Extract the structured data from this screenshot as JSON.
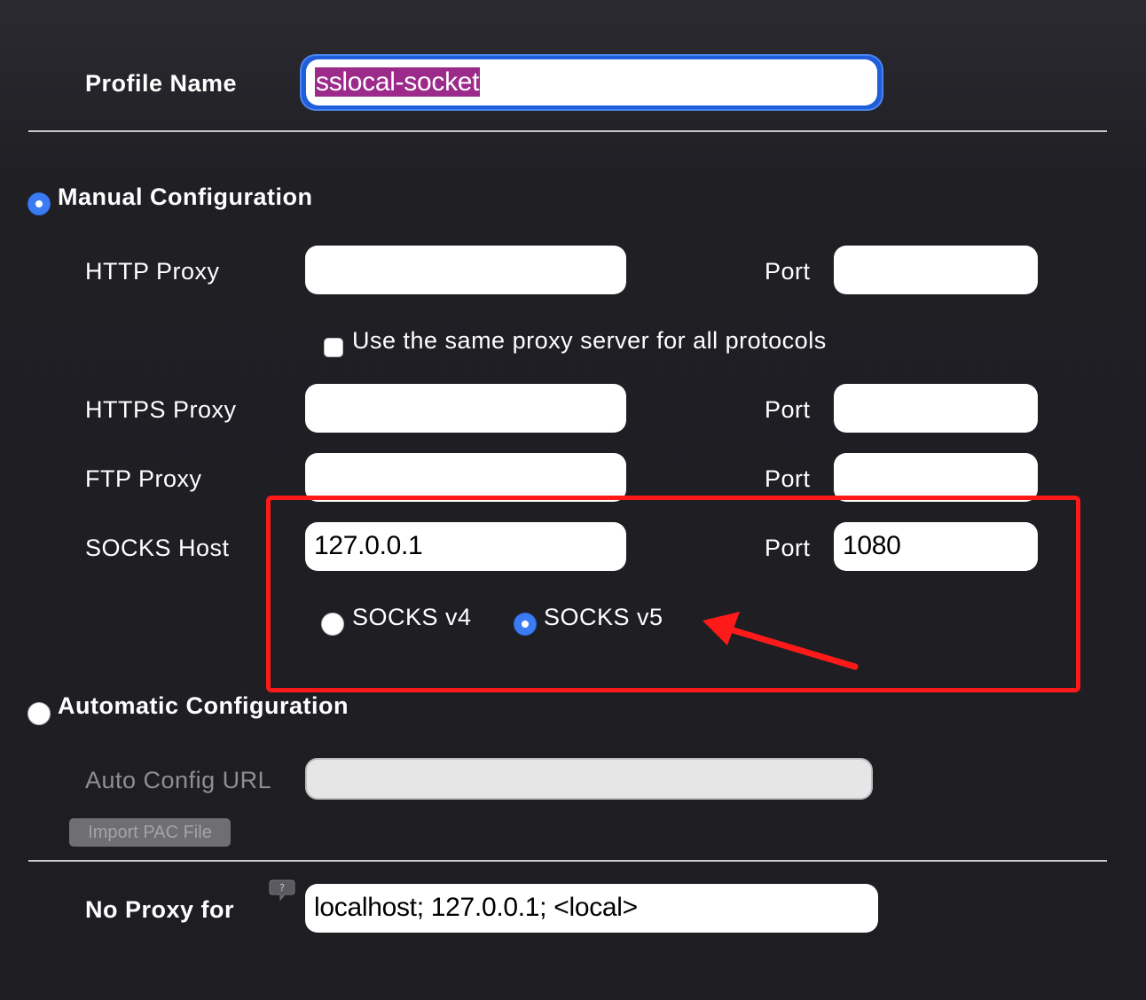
{
  "profile": {
    "label": "Profile Name",
    "value": "sslocal-socket"
  },
  "manual": {
    "title": "Manual Configuration",
    "selected": true,
    "http": {
      "label": "HTTP Proxy",
      "value": "",
      "port_label": "Port",
      "port": ""
    },
    "same_proxy_label": "Use the same proxy server for all protocols",
    "same_proxy_checked": false,
    "https": {
      "label": "HTTPS Proxy",
      "value": "",
      "port_label": "Port",
      "port": ""
    },
    "ftp": {
      "label": "FTP Proxy",
      "value": "",
      "port_label": "Port",
      "port": ""
    },
    "socks": {
      "label": "SOCKS Host",
      "value": "127.0.0.1",
      "port_label": "Port",
      "port": "1080",
      "v4_label": "SOCKS v4",
      "v5_label": "SOCKS v5",
      "selected_version": "SOCKS v5"
    }
  },
  "automatic": {
    "title": "Automatic Configuration",
    "selected": false,
    "url_label": "Auto Config URL",
    "url_value": "",
    "import_button": "Import PAC File"
  },
  "no_proxy": {
    "label": "No Proxy for",
    "help_icon": "help-bubble-icon",
    "value": "localhost; 127.0.0.1; <local>"
  },
  "annotation": {
    "color": "#ff1a1a",
    "shape": "highlight-box-with-arrow"
  },
  "colors": {
    "accent": "#3b7cf5",
    "background": "#1f1f24",
    "selection": "#9b2a8a"
  }
}
